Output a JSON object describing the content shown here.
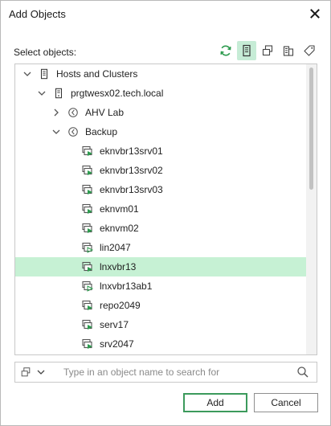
{
  "window": {
    "title": "Add Objects"
  },
  "header": {
    "select_label": "Select objects:"
  },
  "toolbar": {
    "buttons": [
      {
        "name": "refresh-icon",
        "active": false
      },
      {
        "name": "hosts-view-icon",
        "active": true
      },
      {
        "name": "vms-view-icon",
        "active": false
      },
      {
        "name": "datastores-view-icon",
        "active": false
      },
      {
        "name": "tags-view-icon",
        "active": false
      }
    ]
  },
  "tree": {
    "items": [
      {
        "label": "Hosts and Clusters",
        "level": 0,
        "expander": "expanded",
        "icon": "hosts-clusters-icon"
      },
      {
        "label": "prgtwesx02.tech.local",
        "level": 1,
        "expander": "expanded",
        "icon": "host-server-icon"
      },
      {
        "label": "AHV Lab",
        "level": 2,
        "expander": "collapsed",
        "icon": "resource-pool-icon"
      },
      {
        "label": "Backup",
        "level": 2,
        "expander": "expanded",
        "icon": "resource-pool-icon"
      },
      {
        "label": "eknvbr13srv01",
        "level": 3,
        "expander": "none",
        "icon": "vm-running-icon"
      },
      {
        "label": "eknvbr13srv02",
        "level": 3,
        "expander": "none",
        "icon": "vm-running-icon"
      },
      {
        "label": "eknvbr13srv03",
        "level": 3,
        "expander": "none",
        "icon": "vm-running-icon"
      },
      {
        "label": "eknvm01",
        "level": 3,
        "expander": "none",
        "icon": "vm-running-icon"
      },
      {
        "label": "eknvm02",
        "level": 3,
        "expander": "none",
        "icon": "vm-running-icon"
      },
      {
        "label": "lin2047",
        "level": 3,
        "expander": "none",
        "icon": "vm-stopped-icon"
      },
      {
        "label": "lnxvbr13",
        "level": 3,
        "expander": "none",
        "icon": "vm-running-icon",
        "selected": true
      },
      {
        "label": "lnxvbr13ab1",
        "level": 3,
        "expander": "none",
        "icon": "vm-stopped-icon"
      },
      {
        "label": "repo2049",
        "level": 3,
        "expander": "none",
        "icon": "vm-running-icon"
      },
      {
        "label": "serv17",
        "level": 3,
        "expander": "none",
        "icon": "vm-running-icon"
      },
      {
        "label": "srv2047",
        "level": 3,
        "expander": "none",
        "icon": "vm-running-icon"
      }
    ]
  },
  "search": {
    "placeholder": "Type in an object name to search for",
    "value": ""
  },
  "buttons": {
    "add_label": "Add",
    "cancel_label": "Cancel"
  },
  "colors": {
    "accent": "#3c9a5c",
    "selection": "#c6f1d4",
    "toolbar_active": "#c6ecd6"
  }
}
